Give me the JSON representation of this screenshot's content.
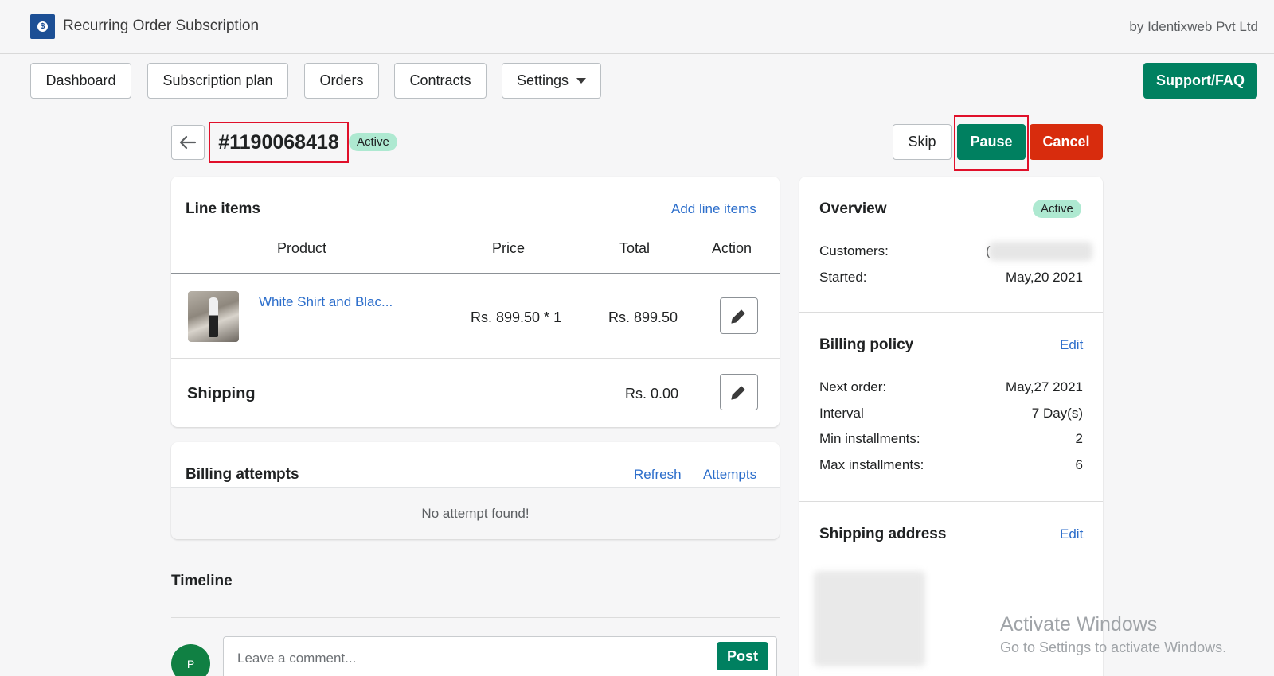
{
  "app": {
    "title": "Recurring Order Subscription",
    "vendor": "by Identixweb Pvt Ltd",
    "logo_symbol": "$"
  },
  "nav": {
    "dashboard": "Dashboard",
    "subscription_plan": "Subscription plan",
    "orders": "Orders",
    "contracts": "Contracts",
    "settings": "Settings",
    "support": "Support/FAQ"
  },
  "header": {
    "order_number": "#1190068418",
    "status": "Active",
    "skip": "Skip",
    "pause": "Pause",
    "cancel": "Cancel"
  },
  "line_items": {
    "title": "Line items",
    "add_link": "Add line items",
    "columns": [
      "Product",
      "Price",
      "Total",
      "Action"
    ],
    "items": [
      {
        "product": "White Shirt and Blac...",
        "price": "Rs. 899.50 * 1",
        "total": "Rs. 899.50"
      }
    ],
    "shipping_label": "Shipping",
    "shipping_total": "Rs. 0.00"
  },
  "billing_attempts": {
    "title": "Billing attempts",
    "refresh": "Refresh",
    "attempts": "Attempts",
    "empty": "No attempt found!"
  },
  "timeline": {
    "title": "Timeline",
    "avatar_initial": "P",
    "comment_placeholder": "Leave a comment...",
    "post": "Post"
  },
  "overview": {
    "title": "Overview",
    "status": "Active",
    "customers_label": "Customers:",
    "customers_value": "(",
    "started_label": "Started:",
    "started_value": "May,20 2021"
  },
  "billing_policy": {
    "title": "Billing policy",
    "edit": "Edit",
    "next_order_label": "Next order:",
    "next_order_value": "May,27 2021",
    "interval_label": "Interval",
    "interval_value": "7 Day(s)",
    "min_label": "Min installments:",
    "min_value": "2",
    "max_label": "Max installments:",
    "max_value": "6"
  },
  "shipping_address": {
    "title": "Shipping address",
    "edit": "Edit"
  },
  "watermark": {
    "title": "Activate Windows",
    "subtitle": "Go to Settings to activate Windows."
  },
  "colors": {
    "primary": "#008060",
    "danger": "#d82c0d",
    "link": "#2c6ecb",
    "badge": "#aee9d1",
    "highlight": "#e0102a"
  }
}
